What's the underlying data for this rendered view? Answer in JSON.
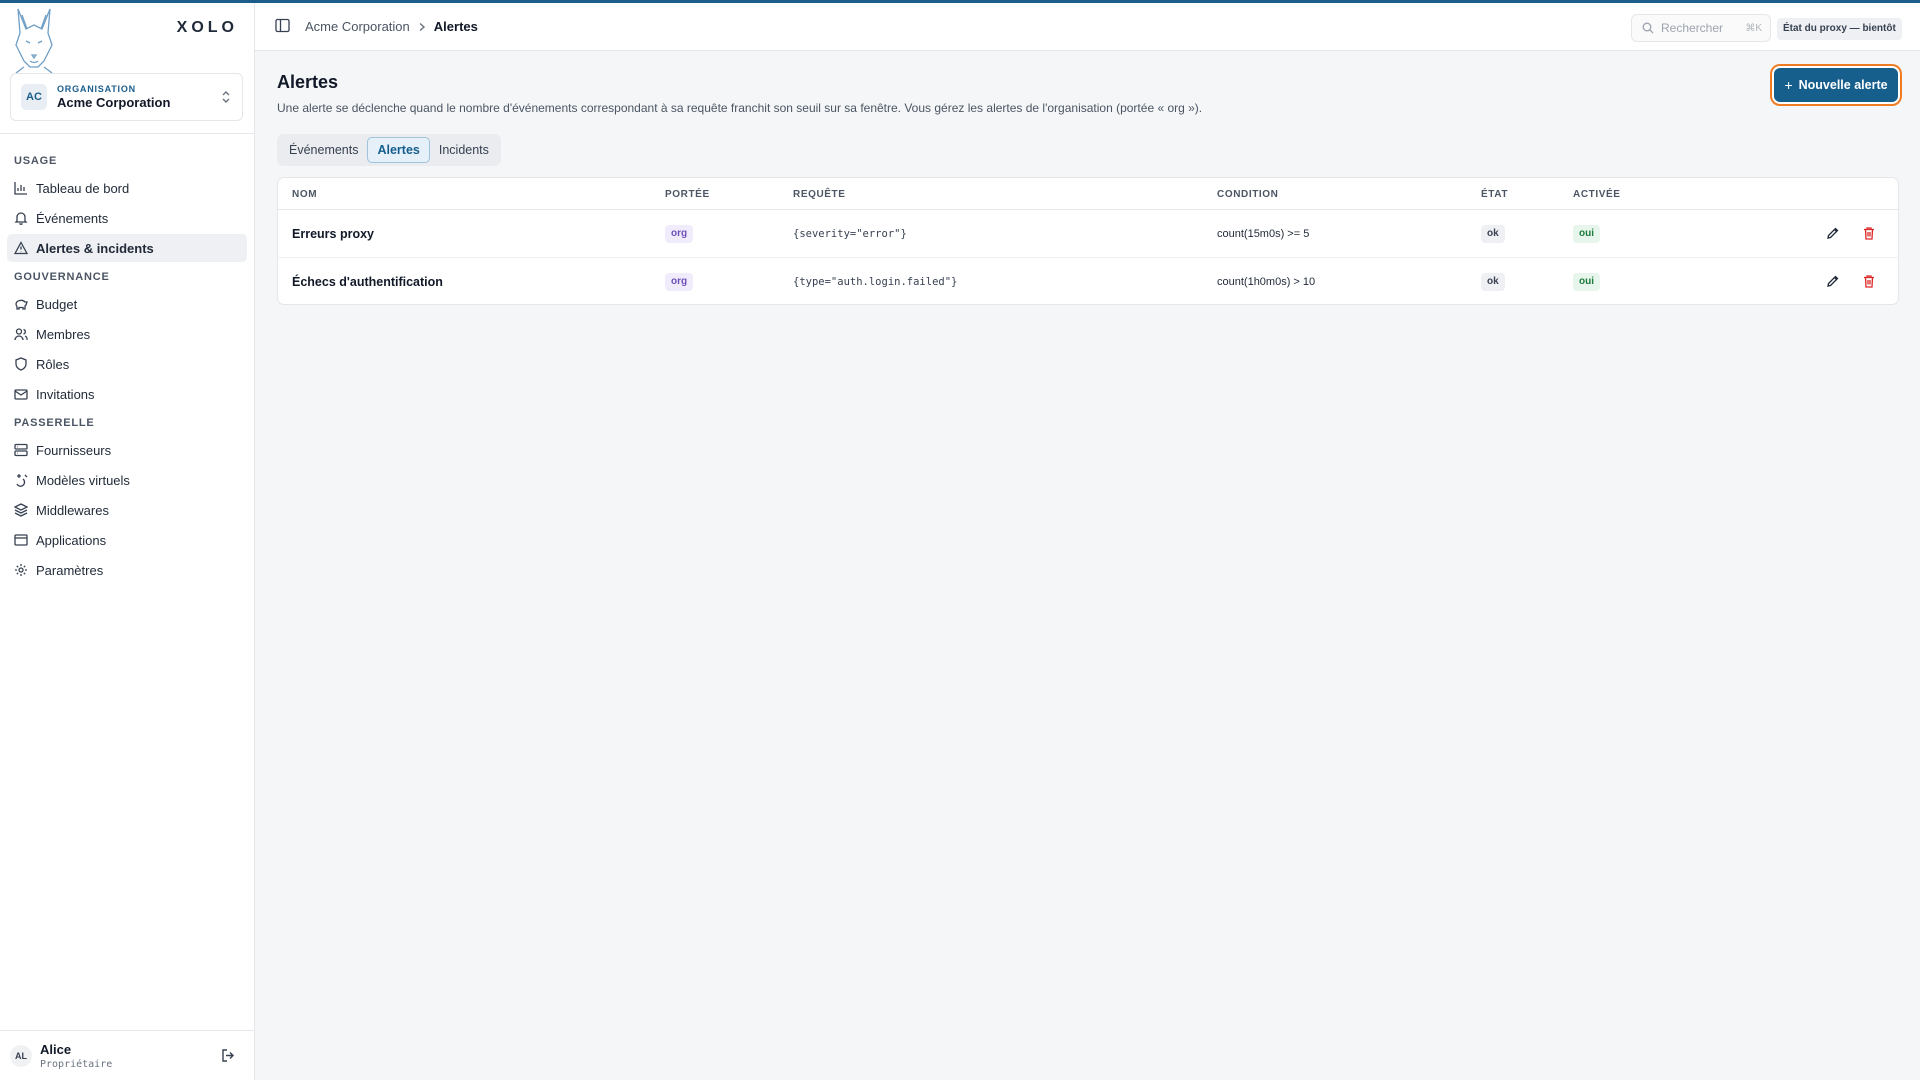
{
  "brand": {
    "name": "XOLO"
  },
  "org": {
    "label": "ORGANISATION",
    "name": "Acme Corporation",
    "initials": "AC"
  },
  "sidebar": {
    "sections": [
      {
        "title": "USAGE",
        "items": [
          "Tableau de bord",
          "Événements",
          "Alertes & incidents"
        ]
      },
      {
        "title": "GOUVERNANCE",
        "items": [
          "Budget",
          "Membres",
          "Rôles",
          "Invitations"
        ]
      },
      {
        "title": "PASSERELLE",
        "items": [
          "Fournisseurs",
          "Modèles virtuels",
          "Middlewares",
          "Applications",
          "Paramètres"
        ]
      }
    ],
    "active_item": "Alertes & incidents"
  },
  "user": {
    "initials": "AL",
    "name": "Alice",
    "role": "Propriétaire"
  },
  "topbar": {
    "breadcrumb": [
      "Acme Corporation",
      "Alertes"
    ],
    "search_placeholder": "Rechercher",
    "search_shortcut": "⌘K",
    "proxy_status": "État du proxy — bientôt"
  },
  "page": {
    "title": "Alertes",
    "description": "Une alerte se déclenche quand le nombre d'événements correspondant à sa requête franchit son seuil sur sa fenêtre. Vous gérez les alertes de l'organisation (portée « org »).",
    "new_button": "Nouvelle alerte",
    "tabs": [
      "Événements",
      "Alertes",
      "Incidents"
    ],
    "active_tab": "Alertes"
  },
  "table": {
    "headers": [
      "NOM",
      "PORTÉE",
      "REQUÊTE",
      "CONDITION",
      "ÉTAT",
      "ACTIVÉE"
    ],
    "rows": [
      {
        "name": "Erreurs proxy",
        "scope": "org",
        "query": "{severity=\"error\"}",
        "condition": "count(15m0s) >= 5",
        "state": "ok",
        "enabled": "oui"
      },
      {
        "name": "Échecs d'authentification",
        "scope": "org",
        "query": "{type=\"auth.login.failed\"}",
        "condition": "count(1h0m0s) > 10",
        "state": "ok",
        "enabled": "oui"
      }
    ]
  },
  "colors": {
    "accent": "#165f8d",
    "focus_ring": "#ef7b22",
    "danger": "#dc2626"
  }
}
